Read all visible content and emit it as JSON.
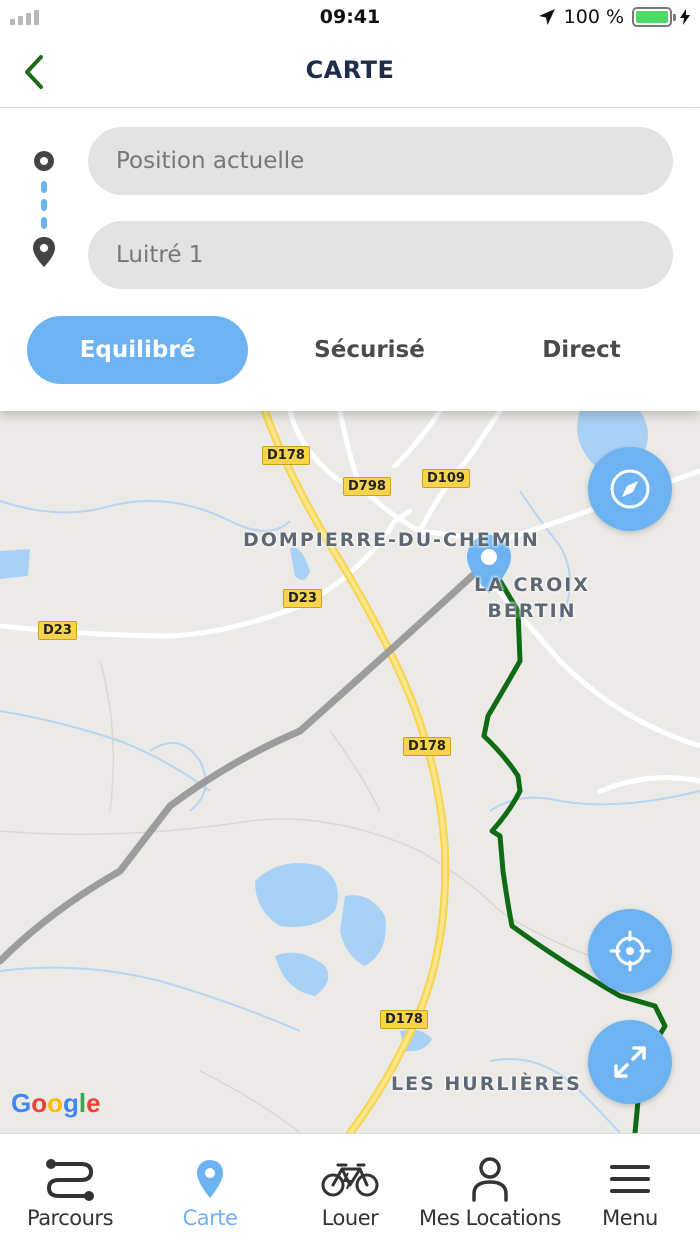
{
  "status_bar": {
    "time": "09:41",
    "battery": "100 %"
  },
  "header": {
    "title": "CARTE"
  },
  "route": {
    "from_placeholder": "Position actuelle",
    "to_value": "Luitré 1",
    "modes": [
      {
        "label": "Equilibré",
        "active": true
      },
      {
        "label": "Sécurisé",
        "active": false
      },
      {
        "label": "Direct",
        "active": false
      }
    ]
  },
  "map": {
    "roads": [
      "D178",
      "D798",
      "D109",
      "D23",
      "D23",
      "D178",
      "D178"
    ],
    "places": [
      "DOMPIERRE-DU-CHEMIN",
      "LA CROIX",
      "BERTIN",
      "LES HURLIÈRES"
    ],
    "attribution": "Google",
    "route_color": "#1a6b1a",
    "accent_color": "#6db3f2"
  },
  "nav": {
    "items": [
      {
        "label": "Parcours",
        "icon": "route-icon"
      },
      {
        "label": "Carte",
        "icon": "map-pin-icon",
        "active": true
      },
      {
        "label": "Louer",
        "icon": "bicycle-icon"
      },
      {
        "label": "Mes Locations",
        "icon": "user-icon"
      },
      {
        "label": "Menu",
        "icon": "hamburger-icon"
      }
    ]
  }
}
